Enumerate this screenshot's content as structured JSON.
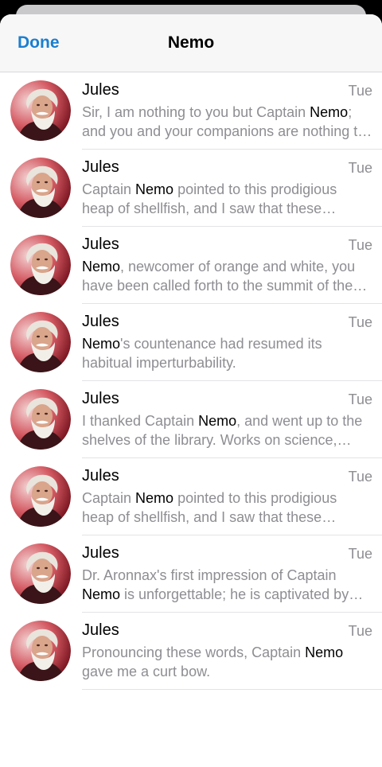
{
  "header": {
    "done_label": "Done",
    "title": "Nemo"
  },
  "messages": [
    {
      "sender": "Jules",
      "time": "Tue",
      "segments": [
        {
          "text": "Sir, I am nothing to you but Captain ",
          "hl": false
        },
        {
          "text": "Nemo",
          "hl": true
        },
        {
          "text": "; and you and your companions are nothing to me but the passengers of the Nautilus.",
          "hl": false
        }
      ]
    },
    {
      "sender": "Jules",
      "time": "Tue",
      "segments": [
        {
          "text": "Captain ",
          "hl": false
        },
        {
          "text": "Nemo",
          "hl": true
        },
        {
          "text": " pointed to this prodigious heap of shellfish, and I saw that these mollusks were all alive.",
          "hl": false
        }
      ]
    },
    {
      "sender": "Jules",
      "time": "Tue",
      "segments": [
        {
          "text": "Nemo",
          "hl": true
        },
        {
          "text": ", newcomer of orange and white, you have been called forth to the summit of the deep.",
          "hl": false
        }
      ]
    },
    {
      "sender": "Jules",
      "time": "Tue",
      "segments": [
        {
          "text": "Nemo",
          "hl": true
        },
        {
          "text": "'s countenance had resumed its habitual imperturbability.",
          "hl": false
        }
      ]
    },
    {
      "sender": "Jules",
      "time": "Tue",
      "segments": [
        {
          "text": "I thanked Captain ",
          "hl": false
        },
        {
          "text": "Nemo",
          "hl": true
        },
        {
          "text": ", and went up to the shelves of the library. Works on science, morals, and literature abounded.",
          "hl": false
        }
      ]
    },
    {
      "sender": "Jules",
      "time": "Tue",
      "segments": [
        {
          "text": "Captain ",
          "hl": false
        },
        {
          "text": "Nemo",
          "hl": true
        },
        {
          "text": " pointed to this prodigious heap of shellfish, and I saw that these mollusks were all alive.",
          "hl": false
        }
      ]
    },
    {
      "sender": "Jules",
      "time": "Tue",
      "segments": [
        {
          "text": "Dr. Aronnax's first impression of Captain ",
          "hl": false
        },
        {
          "text": "Nemo",
          "hl": true
        },
        {
          "text": " is unforgettable; he is captivated by the man's calm authority.",
          "hl": false
        }
      ]
    },
    {
      "sender": "Jules",
      "time": "Tue",
      "segments": [
        {
          "text": "Pronouncing these words, Captain ",
          "hl": false
        },
        {
          "text": "Nemo",
          "hl": true
        },
        {
          "text": " gave me a curt bow.",
          "hl": false
        }
      ]
    }
  ],
  "colors": {
    "accent": "#1a7fd0",
    "secondary_text": "#8e8e93",
    "primary_text": "#000000"
  },
  "icons": {
    "avatar": "portrait-avatar"
  }
}
